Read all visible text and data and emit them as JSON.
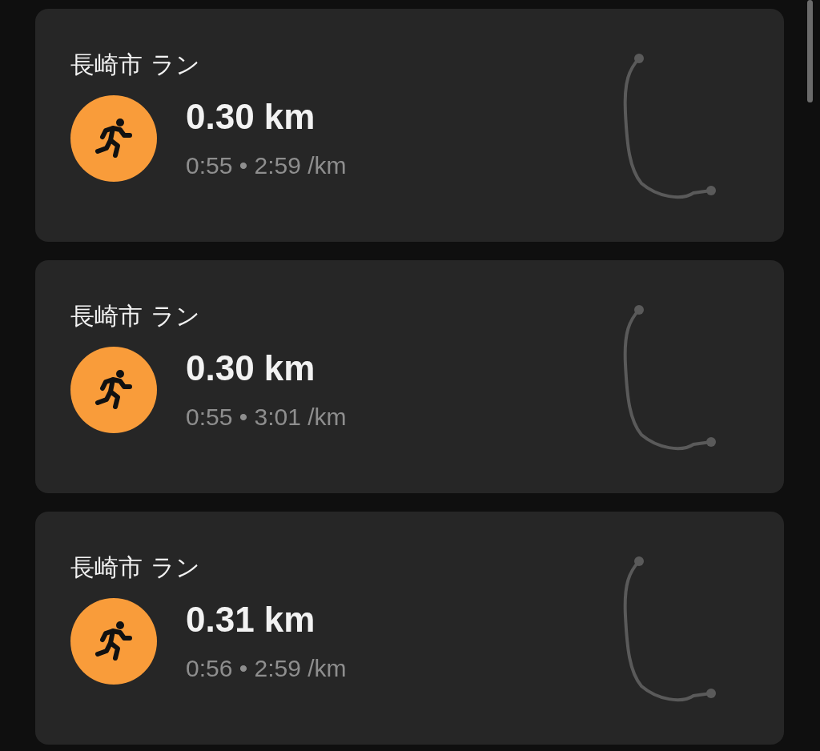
{
  "activities": [
    {
      "title": "長崎市 ラン",
      "distance": "0.30 km",
      "details": "0:55 • 2:59 /km"
    },
    {
      "title": "長崎市 ラン",
      "distance": "0.30 km",
      "details": "0:55 • 3:01 /km"
    },
    {
      "title": "長崎市 ラン",
      "distance": "0.31 km",
      "details": "0:56 • 2:59 /km"
    }
  ]
}
